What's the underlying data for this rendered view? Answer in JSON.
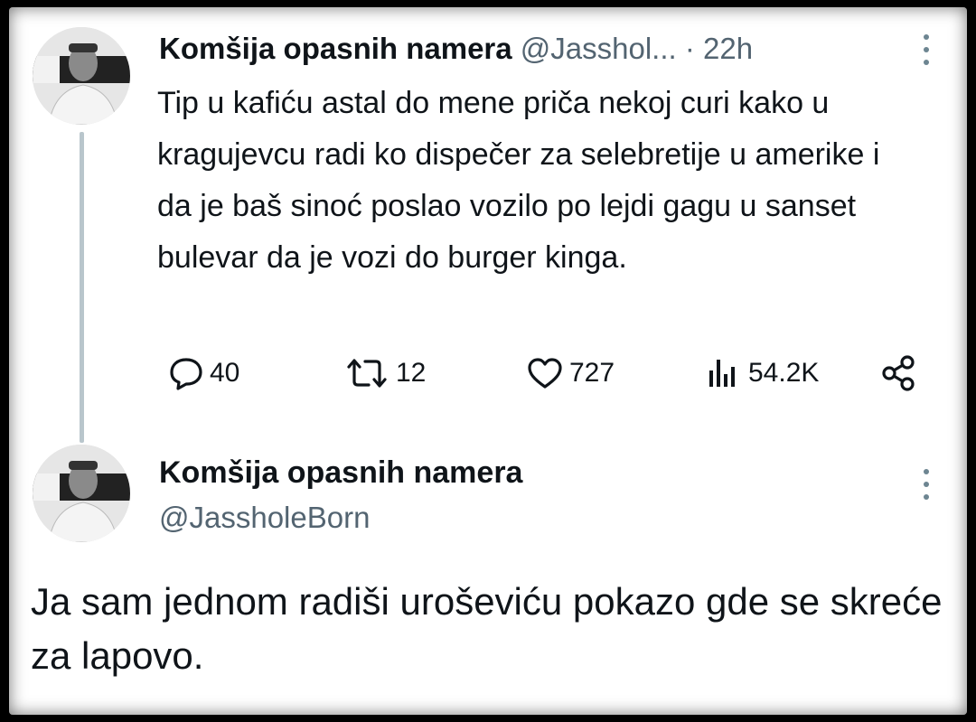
{
  "tweet1": {
    "author_name": "Komšija opasnih namera",
    "handle_truncated": "@Jasshol...",
    "separator": "·",
    "time": "22h",
    "text": "Tip u kafiću astal do mene priča nekoj curi kako u kragujevcu radi ko dispečer za selebretije u amerike i da je baš sinoć poslao vozilo po lejdi gagu u sanset bulevar da je vozi do burger kinga.",
    "stats": {
      "replies": "40",
      "retweets": "12",
      "likes": "727",
      "views": "54.2K"
    },
    "icons": [
      "reply-icon",
      "retweet-icon",
      "like-icon",
      "views-icon",
      "share-icon",
      "more-icon"
    ]
  },
  "tweet2": {
    "author_name": "Komšija opasnih namera",
    "handle": "@JassholeBorn",
    "text": "Ja sam jednom radiši uroševiću pokazo gde se skreće za lapovo.",
    "icons": [
      "more-icon"
    ]
  },
  "colors": {
    "text": "#0f1419",
    "muted": "#536471",
    "thread_line": "#b9c6cc",
    "background": "#ffffff",
    "outer_frame": "#000000"
  }
}
